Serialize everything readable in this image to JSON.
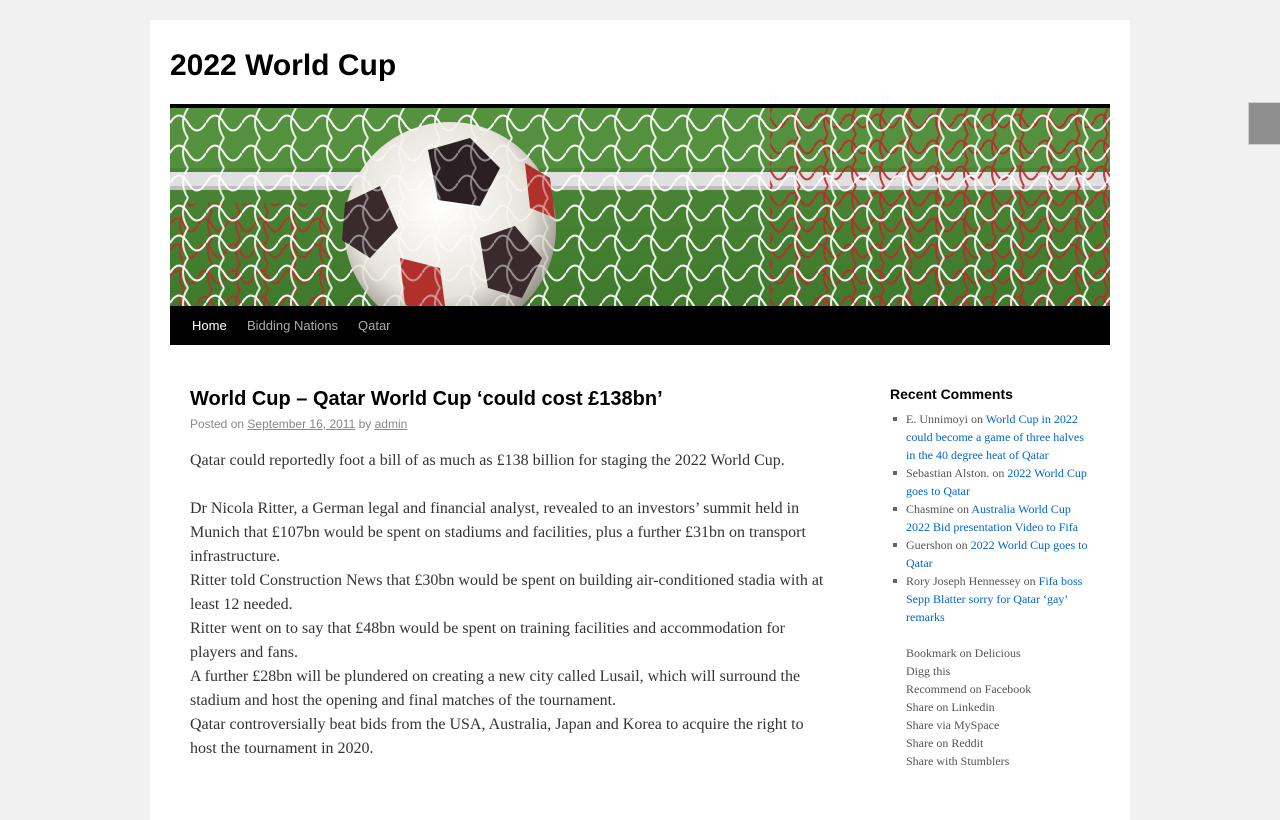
{
  "site": {
    "title": "2022 World Cup"
  },
  "nav": {
    "items": [
      "Home",
      "Bidding Nations",
      "Qatar"
    ]
  },
  "post": {
    "title": "World Cup – Qatar World Cup ‘could cost £138bn’",
    "posted_on_label": "Posted on",
    "date": "September 16, 2011",
    "by_label": "by",
    "author": "admin",
    "paragraphs": [
      "Qatar could reportedly foot a bill of as much as £138 billion for staging the 2022 World Cup.",
      "Dr Nicola Ritter, a German legal and financial analyst, revealed to an investors’ summit held in Munich that £107bn would be spent on stadiums and facilities, plus a further £31bn on transport infrastructure.",
      "Ritter told Construction News that £30bn would be spent on building air-conditioned stadia with at least 12 needed.",
      "Ritter went on to say that £48bn would be spent on training facilities and accommodation for players and fans.",
      "A further £28bn will be plundered on creating a new city called Lusail, which will surround the stadium and host the opening and final matches of the tournament.",
      "Qatar controversially beat bids from the USA, Australia, Japan and Korea to acquire the right to host the tournament in 2020."
    ]
  },
  "sidebar": {
    "recent_comments_title": "Recent Comments",
    "on_label": "on",
    "comments": [
      {
        "author": "E. Unnimoyi",
        "link": "World Cup in 2022 could become a game of three halves in the 40 degree heat of Qatar"
      },
      {
        "author": "Sebastian Alston.",
        "link": "2022 World Cup goes to Qatar"
      },
      {
        "author": "Chasmine",
        "link": "Australia World Cup 2022 Bid presentation Video to Fifa"
      },
      {
        "author": "Guershon",
        "link": "2022 World Cup goes to Qatar"
      },
      {
        "author": "Rory Joseph Hennessey",
        "link": "Fifa boss Sepp Blatter sorry for Qatar ‘gay’ remarks"
      }
    ],
    "share_links": [
      "Bookmark on Delicious",
      "Digg this",
      "Recommend on Facebook",
      "Share on Linkedin",
      "Share via MySpace",
      "Share on Reddit",
      "Share with Stumblers"
    ]
  },
  "colors": {
    "link": "#0066cc",
    "nav_bg": "#000000",
    "page_bg": "#f1f1f1"
  },
  "banner": {
    "icon": "soccer-ball-in-net-image"
  }
}
